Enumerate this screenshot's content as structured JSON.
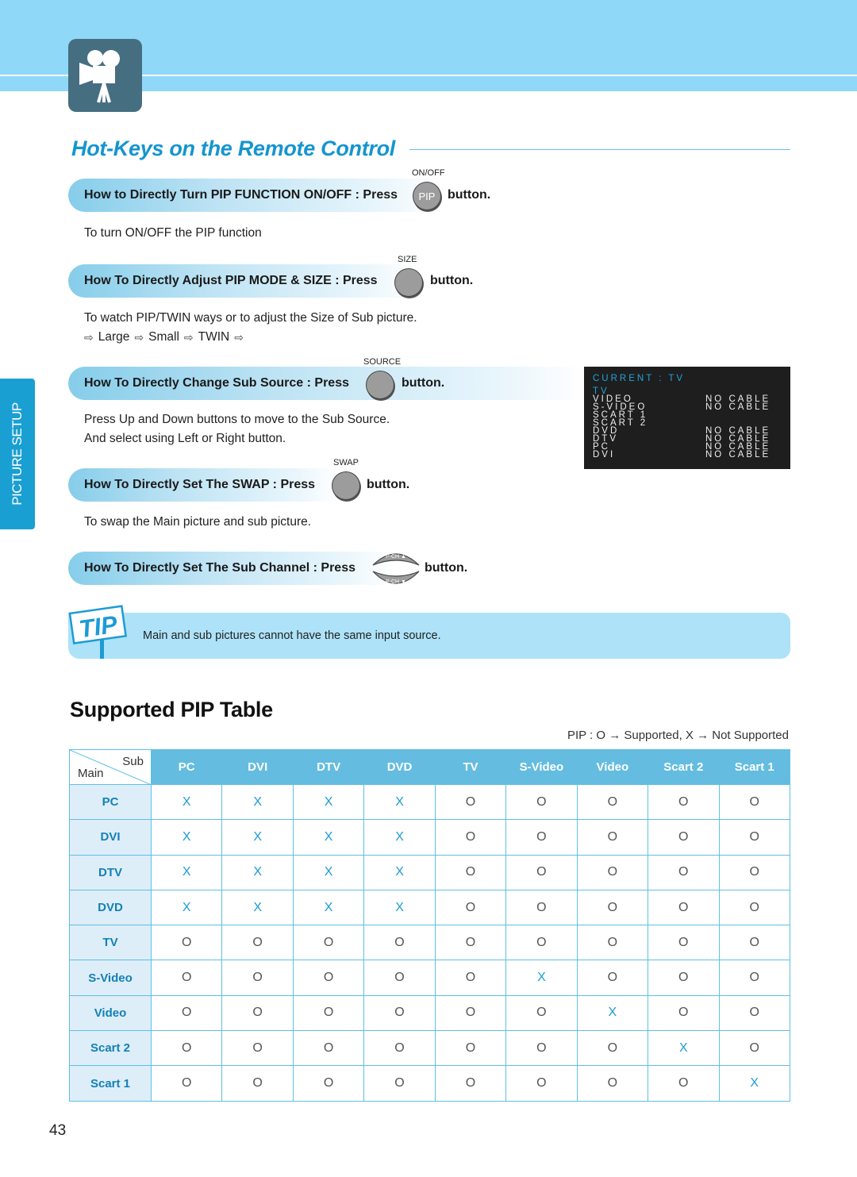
{
  "page": {
    "number": "43",
    "side_tab": "PICTURE SETUP",
    "section_title": "Hot-Keys on the Remote Control",
    "header_icon": "movie-camera-icon"
  },
  "hotkeys": [
    {
      "title": "How to Directly Turn PIP FUNCTION ON/OFF : Press",
      "button_caption": "ON/OFF",
      "button_label": "PIP",
      "suffix": "button.",
      "description": [
        "To turn ON/OFF the PIP function"
      ]
    },
    {
      "title": "How To Directly Adjust PIP MODE & SIZE : Press",
      "button_caption": "SIZE",
      "button_label": "",
      "suffix": "button.",
      "description": [
        "To watch PIP/TWIN ways or to adjust the Size of Sub picture."
      ],
      "sequence": [
        "Large",
        "Small",
        "TWIN"
      ]
    },
    {
      "title": "How To Directly Change Sub Source : Press",
      "button_caption": "SOURCE",
      "button_label": "",
      "suffix": "button.",
      "description": [
        "Press Up and Down buttons to move to the Sub Source.",
        "And select using Left or Right button."
      ]
    },
    {
      "title": "How To Directly Set The SWAP : Press",
      "button_caption": "SWAP",
      "button_label": "",
      "suffix": "button.",
      "description": [
        "To swap the Main picture and sub picture."
      ]
    },
    {
      "title": "How To Directly Set The Sub Channel : Press",
      "button_caption": "",
      "button_up_label": "P-CH ▲",
      "button_down_label": "P-CH ▼",
      "suffix": "button.",
      "description": []
    }
  ],
  "osd": {
    "header": "CURRENT : TV",
    "rows": [
      {
        "name": "TV",
        "status": "",
        "active": true
      },
      {
        "name": "VIDEO",
        "status": "NO  CABLE"
      },
      {
        "name": "S-VIDEO",
        "status": "NO  CABLE"
      },
      {
        "name": "SCART 1",
        "status": ""
      },
      {
        "name": "SCART 2",
        "status": ""
      },
      {
        "name": "DVD",
        "status": "NO  CABLE"
      },
      {
        "name": "DTV",
        "status": "NO  CABLE"
      },
      {
        "name": "PC",
        "status": "NO  CABLE"
      },
      {
        "name": "DVI",
        "status": "NO  CABLE"
      }
    ]
  },
  "tip": {
    "badge": "TIP",
    "text": "Main and sub pictures cannot have the same input source."
  },
  "pip_table": {
    "title": "Supported PIP Table",
    "legend": "PIP : O → Supported,  X → Not Supported",
    "corner_sub": "Sub",
    "corner_main": "Main",
    "columns": [
      "PC",
      "DVI",
      "DTV",
      "DVD",
      "TV",
      "S-Video",
      "Video",
      "Scart 2",
      "Scart 1"
    ],
    "rows": [
      {
        "main": "PC",
        "values": [
          "X",
          "X",
          "X",
          "X",
          "O",
          "O",
          "O",
          "O",
          "O"
        ]
      },
      {
        "main": "DVI",
        "values": [
          "X",
          "X",
          "X",
          "X",
          "O",
          "O",
          "O",
          "O",
          "O"
        ]
      },
      {
        "main": "DTV",
        "values": [
          "X",
          "X",
          "X",
          "X",
          "O",
          "O",
          "O",
          "O",
          "O"
        ]
      },
      {
        "main": "DVD",
        "values": [
          "X",
          "X",
          "X",
          "X",
          "O",
          "O",
          "O",
          "O",
          "O"
        ]
      },
      {
        "main": "TV",
        "values": [
          "O",
          "O",
          "O",
          "O",
          "O",
          "O",
          "O",
          "O",
          "O"
        ]
      },
      {
        "main": "S-Video",
        "values": [
          "O",
          "O",
          "O",
          "O",
          "O",
          "X",
          "O",
          "O",
          "O"
        ]
      },
      {
        "main": "Video",
        "values": [
          "O",
          "O",
          "O",
          "O",
          "O",
          "O",
          "X",
          "O",
          "O"
        ]
      },
      {
        "main": "Scart 2",
        "values": [
          "O",
          "O",
          "O",
          "O",
          "O",
          "O",
          "O",
          "X",
          "O"
        ]
      },
      {
        "main": "Scart 1",
        "values": [
          "O",
          "O",
          "O",
          "O",
          "O",
          "O",
          "O",
          "O",
          "X"
        ]
      }
    ]
  },
  "colors": {
    "accent": "#1595cf",
    "band": "#8fd8f7",
    "table_header": "#64bce0",
    "row_header_bg": "#ddeef9"
  }
}
